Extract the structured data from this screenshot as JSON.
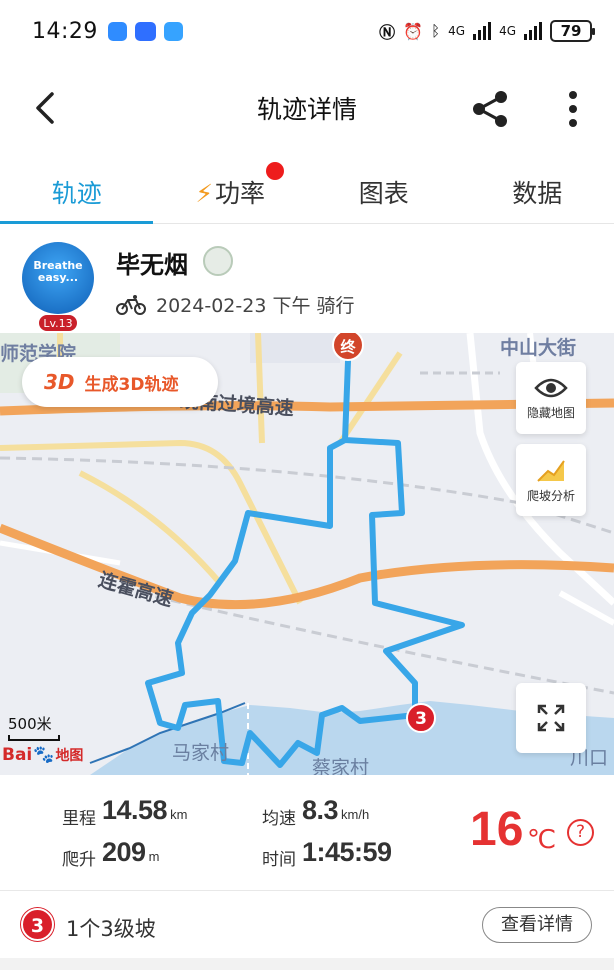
{
  "status_bar": {
    "time": "14:29",
    "network_1": "4G",
    "network_2": "4G",
    "battery": "79"
  },
  "header": {
    "title": "轨迹详情"
  },
  "tabs": [
    {
      "label": "轨迹",
      "active": true
    },
    {
      "label": "功率",
      "has_dot": true
    },
    {
      "label": "图表"
    },
    {
      "label": "数据"
    }
  ],
  "profile": {
    "avatar_text": "Breathe easy...",
    "level": "Lv.13",
    "name": "毕无烟",
    "meta": "2024-02-23 下午 骑行"
  },
  "map": {
    "btn_3d_prefix": "3D",
    "btn_3d_label": "生成3D轨迹",
    "hide_map_label": "隐藏地图",
    "climb_analysis_label": "爬坡分析",
    "scale_label": "500米",
    "logo_text_1": "Bai",
    "logo_text_2": "地图",
    "end_marker": "终",
    "climb_marker": "3",
    "labels": {
      "school": "师范学院",
      "street": "中山大街",
      "highway1": "绕南过境高速",
      "highway2": "连霍高速",
      "village1": "马家村",
      "village2": "蔡家村",
      "exit": "川口"
    }
  },
  "stats": {
    "distance_label": "里程",
    "distance_value": "14.58",
    "distance_unit": "km",
    "climb_label": "爬升",
    "climb_value": "209",
    "climb_unit": "m",
    "avg_speed_label": "均速",
    "avg_speed_value": "8.3",
    "avg_speed_unit": "km/h",
    "time_label": "时间",
    "time_value": "1:45:59",
    "temperature": "16",
    "temperature_unit": "℃",
    "help": "?"
  },
  "climb_row": {
    "badge": "3",
    "text": "1个3级坡",
    "detail_button": "查看详情"
  },
  "colors": {
    "accent": "#1a9bd6",
    "temperature": "#e53232",
    "track": "#38a6e8",
    "highway": "#f2a45a"
  }
}
